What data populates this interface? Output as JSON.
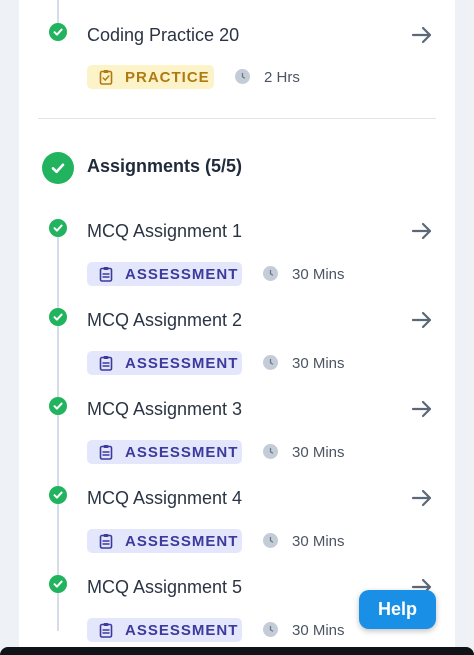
{
  "practice_item": {
    "title": "Coding Practice 20",
    "badge": "PRACTICE",
    "duration": "2 Hrs"
  },
  "section": {
    "title": "Assignments (5/5)"
  },
  "assignments": [
    {
      "title": "MCQ Assignment 1",
      "badge": "ASSESSMENT",
      "duration": "30 Mins"
    },
    {
      "title": "MCQ Assignment 2",
      "badge": "ASSESSMENT",
      "duration": "30 Mins"
    },
    {
      "title": "MCQ Assignment 3",
      "badge": "ASSESSMENT",
      "duration": "30 Mins"
    },
    {
      "title": "MCQ Assignment 4",
      "badge": "ASSESSMENT",
      "duration": "30 Mins"
    },
    {
      "title": "MCQ Assignment 5",
      "badge": "ASSESSMENT",
      "duration": "30 Mins"
    }
  ],
  "help_button": "Help",
  "colors": {
    "complete_green": "#22b35e",
    "assessment_badge_bg": "#e4e7fb",
    "assessment_badge_text": "#3d3a9e",
    "practice_badge_bg": "#fcf3c8",
    "practice_badge_text": "#b07a13",
    "help_blue": "#1a8fe6"
  },
  "icons": {
    "completion": "check-circle-icon",
    "navigate": "arrow-right-icon",
    "badge": "clipboard-icon",
    "duration": "clock-icon"
  }
}
